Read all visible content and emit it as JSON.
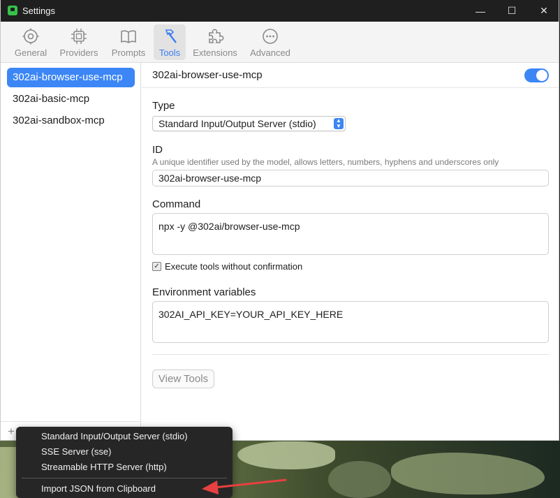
{
  "window": {
    "title": "Settings",
    "controls": {
      "minimize": "—",
      "maximize": "☐",
      "close": "✕"
    }
  },
  "toolbar": {
    "tabs": [
      {
        "label": "General",
        "icon": "gear-icon",
        "active": false
      },
      {
        "label": "Providers",
        "icon": "chip-icon",
        "active": false
      },
      {
        "label": "Prompts",
        "icon": "book-icon",
        "active": false
      },
      {
        "label": "Tools",
        "icon": "hammer-icon",
        "active": true
      },
      {
        "label": "Extensions",
        "icon": "puzzle-icon",
        "active": false
      },
      {
        "label": "Advanced",
        "icon": "ellipsis-icon",
        "active": false
      }
    ]
  },
  "sidebar": {
    "servers": [
      {
        "label": "302ai-browser-use-mcp",
        "selected": true
      },
      {
        "label": "302ai-basic-mcp",
        "selected": false
      },
      {
        "label": "302ai-sandbox-mcp",
        "selected": false
      }
    ],
    "add_label": "+"
  },
  "detail": {
    "server_name": "302ai-browser-use-mcp",
    "enabled": true,
    "type_label": "Type",
    "type_value": "Standard Input/Output Server (stdio)",
    "id_label": "ID",
    "id_hint": "A unique identifier used by the model, allows letters, numbers, hyphens and underscores only",
    "id_value": "302ai-browser-use-mcp",
    "command_label": "Command",
    "command_value": "npx -y @302ai/browser-use-mcp",
    "execute_label": "Execute tools without confirmation",
    "execute_checked": true,
    "env_label": "Environment variables",
    "env_value": "302AI_API_KEY=YOUR_API_KEY_HERE",
    "view_tools_label": "View Tools"
  },
  "context_menu": {
    "items": [
      "Standard Input/Output Server (stdio)",
      "SSE Server (sse)",
      "Streamable HTTP Server (http)",
      "Import JSON from Clipboard"
    ]
  },
  "colors": {
    "accent": "#3c86f5",
    "titlebar": "#1f1f1f",
    "menu_bg": "#262626",
    "annotation_arrow": "#e84040"
  }
}
